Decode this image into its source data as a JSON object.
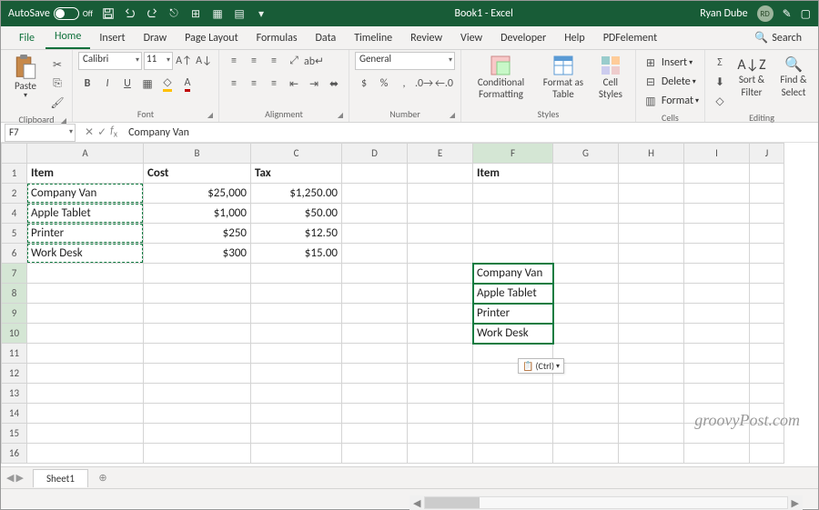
{
  "titlebar": {
    "autosave": "AutoSave",
    "autosave_state": "Off",
    "title": "Book1 - Excel",
    "user": "Ryan Dube",
    "initials": "RD"
  },
  "tabs": [
    "File",
    "Home",
    "Insert",
    "Draw",
    "Page Layout",
    "Formulas",
    "Data",
    "Timeline",
    "Review",
    "View",
    "Developer",
    "Help",
    "PDFelement"
  ],
  "search": "Search",
  "ribbon": {
    "clipboard": {
      "paste": "Paste",
      "label": "Clipboard"
    },
    "font": {
      "name": "Calibri",
      "size": "11",
      "label": "Font"
    },
    "alignment": {
      "label": "Alignment"
    },
    "number": {
      "format": "General",
      "label": "Number"
    },
    "styles": {
      "cf": "Conditional Formatting",
      "fat": "Format as Table",
      "cs": "Cell Styles",
      "label": "Styles"
    },
    "cells": {
      "insert": "Insert",
      "delete": "Delete",
      "format": "Format",
      "label": "Cells"
    },
    "editing": {
      "sort": "Sort & Filter",
      "find": "Find & Select",
      "label": "Editing"
    }
  },
  "namebox": "F7",
  "formula": "Company Van",
  "columns": [
    "A",
    "B",
    "C",
    "D",
    "E",
    "F",
    "G",
    "H",
    "I",
    "J"
  ],
  "rows": [
    "1",
    "2",
    "4",
    "5",
    "6",
    "7",
    "8",
    "9",
    "10",
    "11",
    "12",
    "13",
    "14",
    "15",
    "16"
  ],
  "cells": {
    "A1": "Item",
    "B1": "Cost",
    "C1": "Tax",
    "F1": "Item",
    "A2": "Company Van",
    "B2": "$25,000",
    "C2": "$1,250.00",
    "A4": "Apple Tablet",
    "B4": "$1,000",
    "C4": "$50.00",
    "A5": "Printer",
    "B5": "$250",
    "C5": "$12.50",
    "A6": "Work Desk",
    "B6": "$300",
    "C6": "$15.00",
    "F7": "Company Van",
    "F8": "Apple Tablet",
    "F9": "Printer",
    "F10": "Work Desk"
  },
  "paste_options": "(Ctrl)",
  "sheet": "Sheet1",
  "watermark": "groovyPost.com"
}
